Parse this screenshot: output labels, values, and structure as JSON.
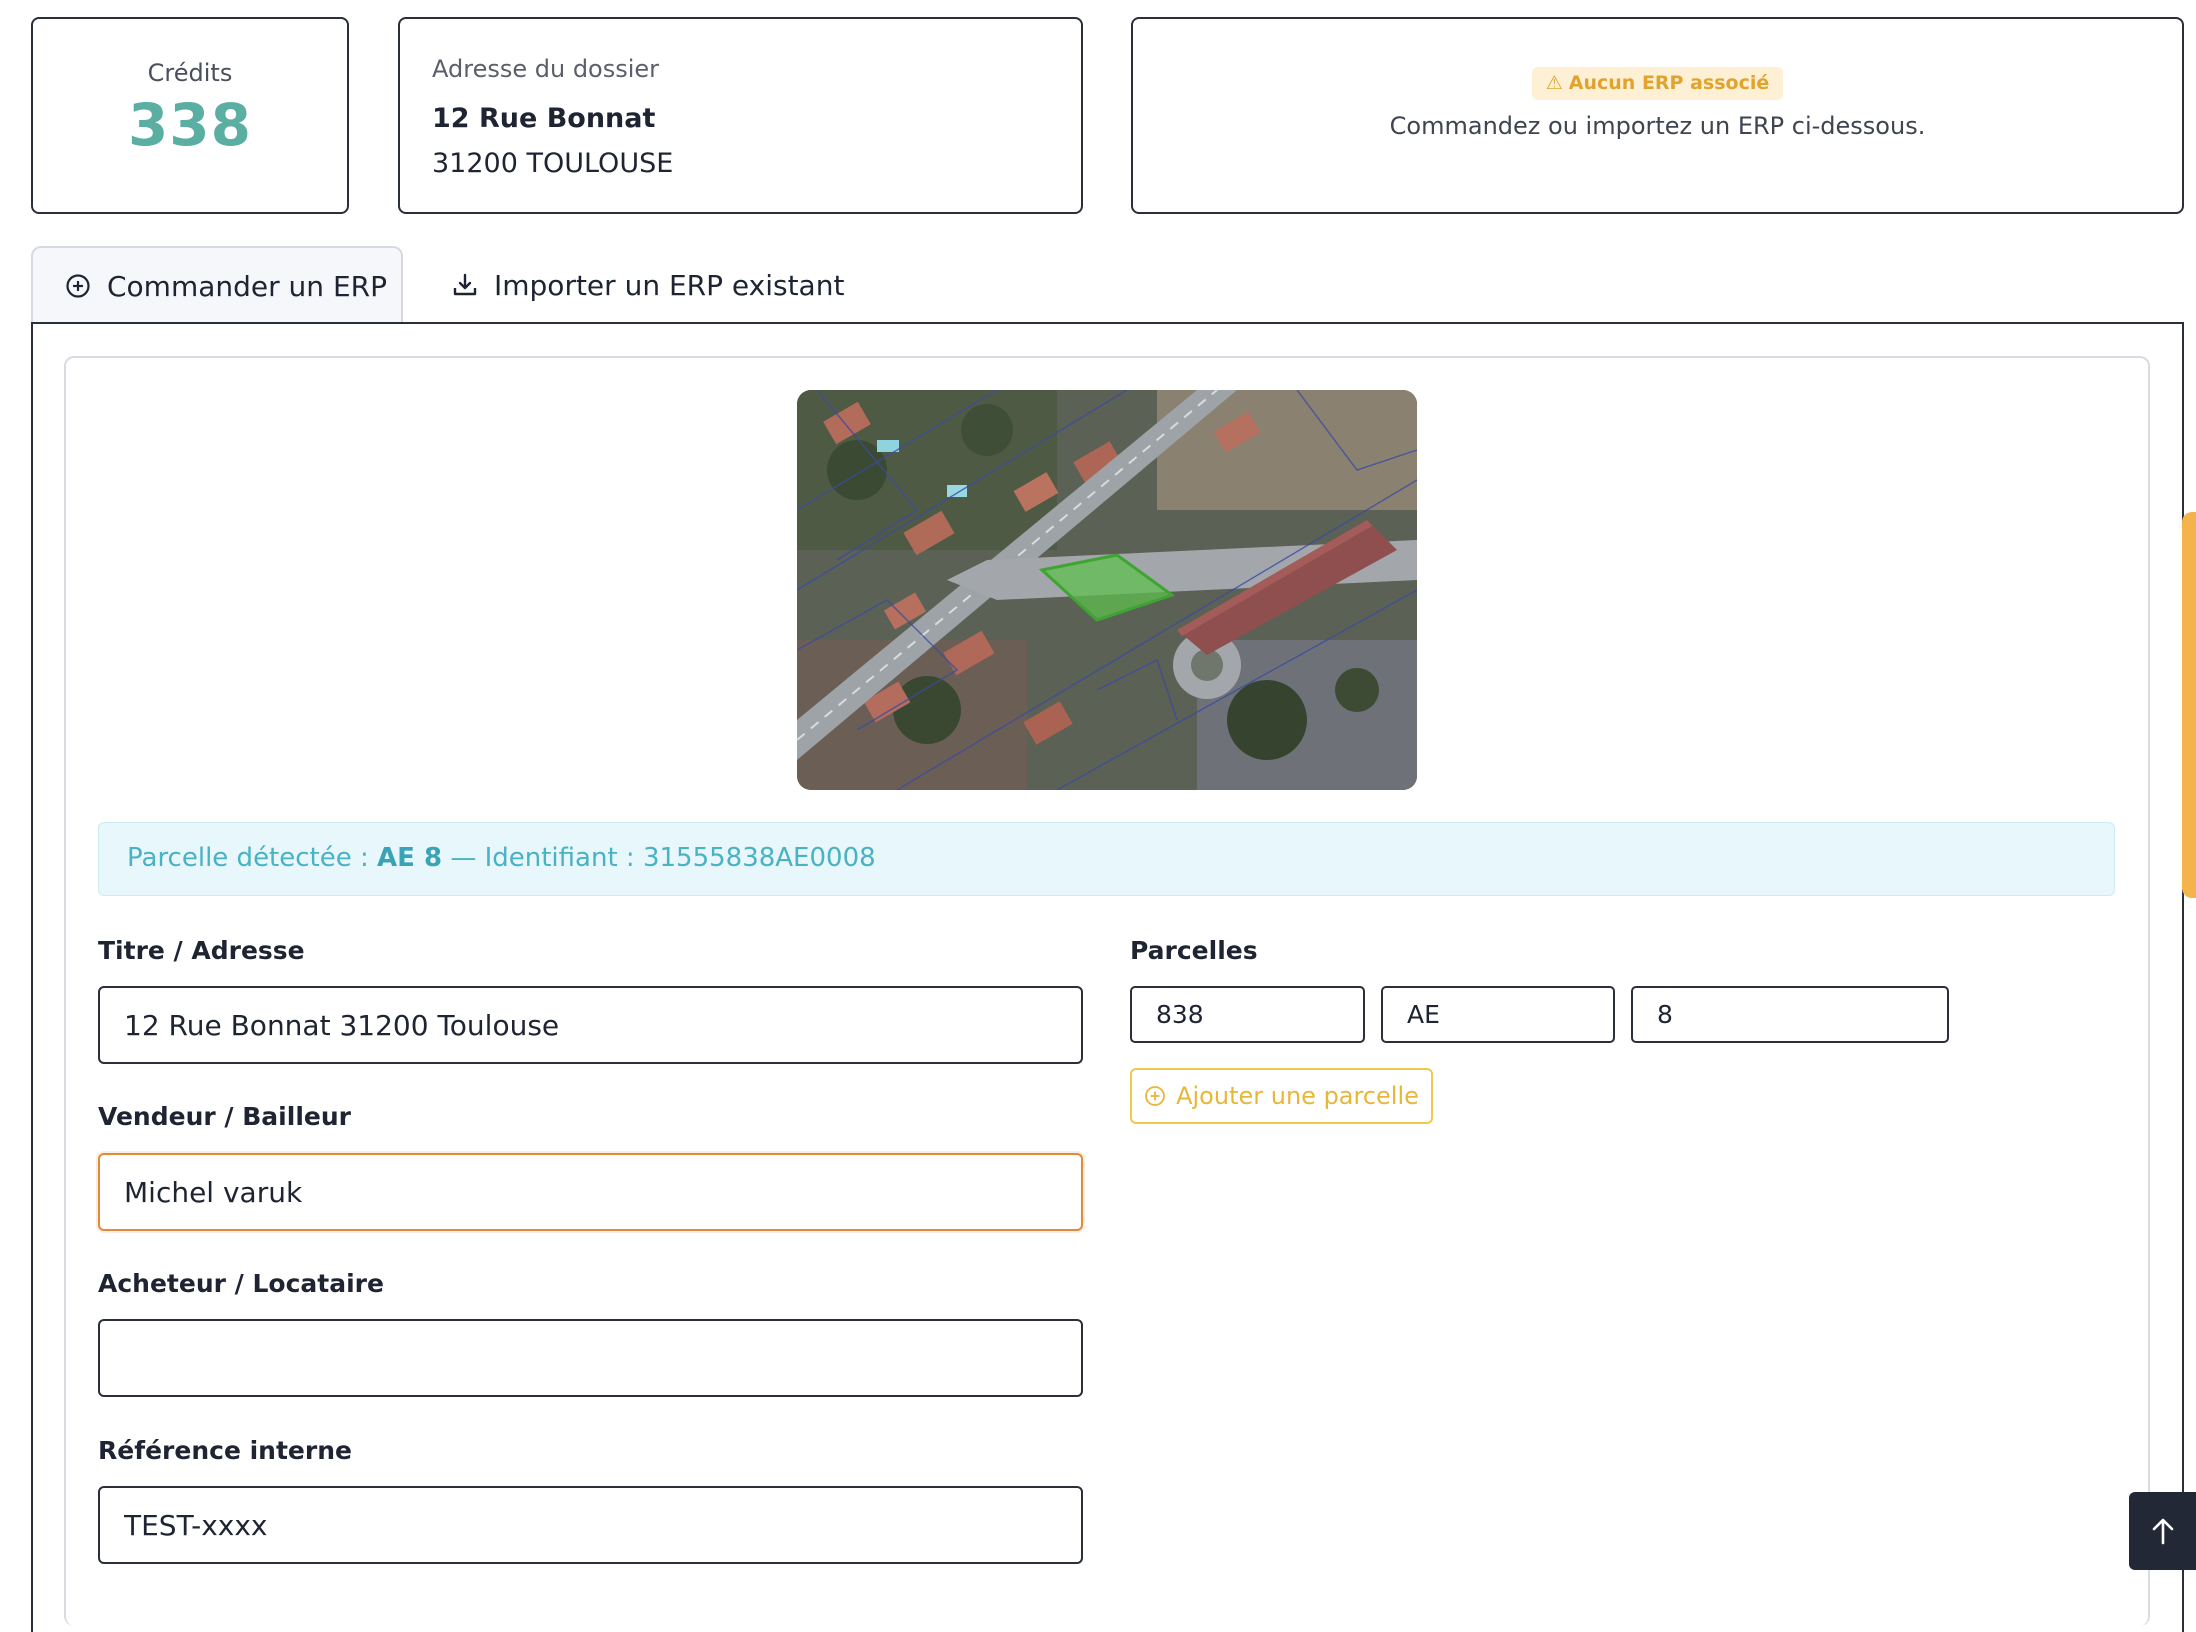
{
  "credits": {
    "label": "Crédits",
    "value": "338"
  },
  "address_card": {
    "label": "Adresse du dossier",
    "line1": "12 Rue Bonnat",
    "line2": "31200 TOULOUSE"
  },
  "erp_status": {
    "badge": "Aucun ERP associé",
    "message": "Commandez ou importez un ERP ci-dessous."
  },
  "tabs": [
    {
      "label": "Commander un ERP",
      "icon": "plus-circle-icon",
      "active": true
    },
    {
      "label": "Importer un ERP existant",
      "icon": "download-icon",
      "active": false
    }
  ],
  "parcel_banner": {
    "prefix": "Parcelle détectée : ",
    "parcel": "AE 8",
    "separator": " — Identifiant : ",
    "identifier": "31555838AE0008"
  },
  "form": {
    "title": {
      "label": "Titre / Adresse",
      "value": "12 Rue Bonnat 31200 Toulouse"
    },
    "seller": {
      "label": "Vendeur / Bailleur",
      "value": "Michel varuk"
    },
    "buyer": {
      "label": "Acheteur / Locataire",
      "value": ""
    },
    "reference": {
      "label": "Référence interne",
      "value": "TEST-xxxx"
    },
    "parcels": {
      "label": "Parcelles",
      "fields": [
        "838",
        "AE",
        "8"
      ],
      "add_label": "Ajouter une parcelle"
    }
  },
  "colors": {
    "accent_teal": "#5aaea2",
    "warning": "#e0a32e",
    "focus": "#e08a3c",
    "dark": "#232837"
  }
}
